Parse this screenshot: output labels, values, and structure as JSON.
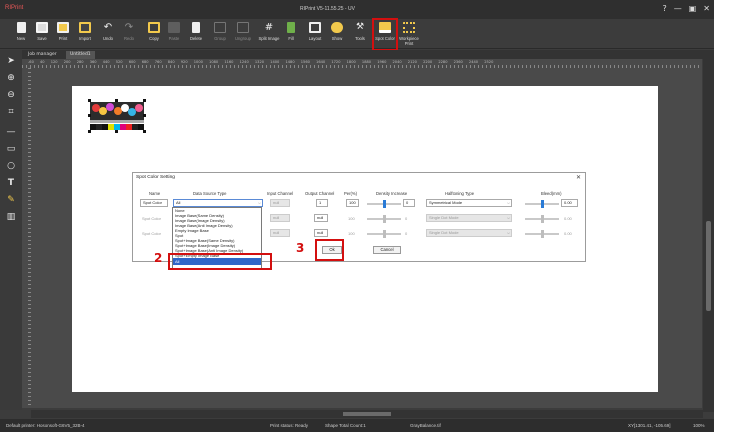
{
  "app": {
    "brand": "RIPrint",
    "title": "RIPrint V5-11.55.25 - UV",
    "window_controls": [
      "?",
      "—",
      "▣",
      "✕"
    ]
  },
  "toolbar": {
    "items": [
      {
        "label": "New",
        "icon": "new-icon",
        "enabled": true
      },
      {
        "label": "Save",
        "icon": "save-icon",
        "enabled": true
      },
      {
        "label": "Print",
        "icon": "print-icon",
        "enabled": true
      },
      {
        "label": "Import",
        "icon": "import-icon",
        "enabled": true
      },
      {
        "label": "Undo",
        "icon": "undo-icon",
        "enabled": true
      },
      {
        "label": "Redo",
        "icon": "redo-icon",
        "enabled": false
      },
      {
        "label": "Copy",
        "icon": "copy-icon",
        "enabled": true
      },
      {
        "label": "Paste",
        "icon": "paste-icon",
        "enabled": false
      },
      {
        "label": "Delete",
        "icon": "delete-icon",
        "enabled": true
      },
      {
        "label": "Group",
        "icon": "group-icon",
        "enabled": false
      },
      {
        "label": "Ungroup",
        "icon": "ungroup-icon",
        "enabled": false
      },
      {
        "label": "Split Image",
        "icon": "split-image-icon",
        "enabled": true
      },
      {
        "label": "Fill",
        "icon": "fill-icon",
        "enabled": true
      },
      {
        "label": "Layout",
        "icon": "layout-icon",
        "enabled": true
      },
      {
        "label": "Show",
        "icon": "show-icon",
        "enabled": true
      },
      {
        "label": "Tools",
        "icon": "tools-icon",
        "enabled": true
      },
      {
        "label": "Spot Color",
        "icon": "spot-color-icon",
        "enabled": true
      },
      {
        "label": "Workpiece Print",
        "icon": "workpiece-print-icon",
        "enabled": true
      }
    ]
  },
  "tabs": [
    {
      "label": "Job manager"
    },
    {
      "label": "Untitled1"
    }
  ],
  "ruler": {
    "numbers": "-60 40 120 200 280 360 440 520 600 680 760 840 920 1000 1080 1160 1240 1320 1400 1480 1560 1640 1720 1800 1880 1960 2040 2120 2200 2280 2360 2440 2520"
  },
  "left_tools": [
    "select-icon",
    "zoom-in-icon",
    "zoom-out-icon",
    "crop-icon",
    "line-icon",
    "rectangle-icon",
    "ellipse-icon",
    "text-icon",
    "pen-icon",
    "barcode-icon"
  ],
  "dialog": {
    "title": "Spot Color Setting",
    "columns": {
      "name": "Name",
      "data_source": "Data Source Type",
      "input_channel": "Input Channel",
      "output_channel": "Output Channel",
      "per": "Per(%)",
      "density": "Density Increase",
      "halftoning": "Halftoning Type",
      "bleed": "Bleed(mm)"
    },
    "rows": [
      {
        "name": "Spot Color",
        "data_source": "All",
        "input": "null",
        "output": "1",
        "per": "100",
        "density": "0",
        "halftoning": "Symmetrical Mode",
        "bleed": "0.00",
        "enabled": true
      },
      {
        "name": "Spot Color",
        "data_source": "",
        "input": "null",
        "output": "null",
        "per": "100",
        "density": "0",
        "halftoning": "Single Dot Mode",
        "bleed": "0.00",
        "enabled": false
      },
      {
        "name": "Spot Color",
        "data_source": "",
        "input": "null",
        "output": "null",
        "per": "100",
        "density": "0",
        "halftoning": "Single Dot Mode",
        "bleed": "0.00",
        "enabled": false
      }
    ],
    "ok_label": "Ok",
    "cancel_label": "Cancel",
    "dropdown_options": [
      "None",
      "Image Base(Same Density)",
      "Image Base(Image Density)",
      "Image Base(Anti Image Density)",
      "Empty Image Base",
      "Spot",
      "Spot+Image Base(Same Density)",
      "Spot+Image Base(Image Density)",
      "Spot+Image Base(Anti Image Density)",
      "Spot+Empty Image Base",
      "All"
    ],
    "dropdown_selected_index": 10
  },
  "annotations": {
    "step2": "2",
    "step3": "3"
  },
  "status": {
    "printer": "Default printer: Hosonsoft-G6V5_32B-4",
    "print_status": "Print status: Ready",
    "shape_count": "Shape Total Count:1",
    "file": "GrayBalance.tif",
    "coords": "XY[1301.41, -105.69]",
    "zoom": "100%"
  },
  "colors": {
    "accent_red": "#d30f0f",
    "selection_blue": "#2f66c8",
    "brand_red": "#e85757"
  }
}
